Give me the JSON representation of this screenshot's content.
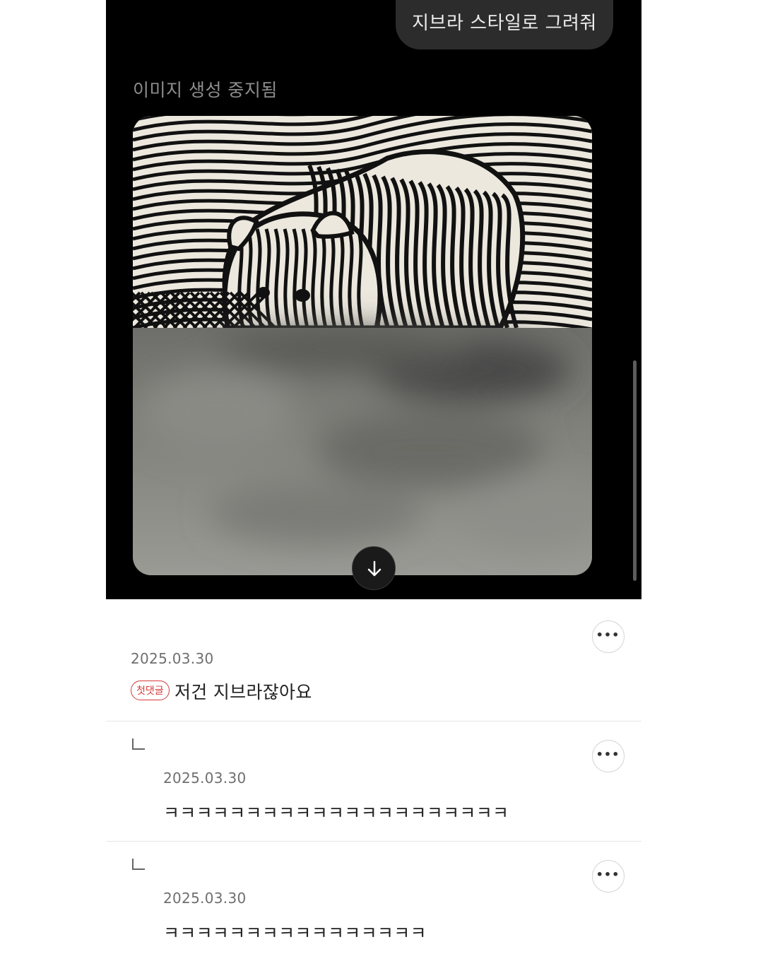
{
  "chat": {
    "user_prompt": "지브라 스타일로 그려줘",
    "status_text": "이미지 생성 중지됨",
    "image_label": "zebra-striped animal artwork, lower half blurred"
  },
  "icons": {
    "scroll_down": "arrow-down-icon",
    "more": "more-horizontal-icon",
    "reply": "reply-corner-icon"
  },
  "comments": [
    {
      "date": "2025.03.30",
      "badge": "첫댓글",
      "text": "저건 지브라잖아요",
      "is_reply": false
    },
    {
      "date": "2025.03.30",
      "text": "ㅋㅋㅋㅋㅋㅋㅋㅋㅋㅋㅋㅋㅋㅋㅋㅋㅋㅋㅋㅋㅋ",
      "is_reply": true
    },
    {
      "date": "2025.03.30",
      "text": "ㅋㅋㅋㅋㅋㅋㅋㅋㅋㅋㅋㅋㅋㅋㅋㅋ",
      "is_reply": true
    }
  ],
  "more_label": "•••",
  "colors": {
    "chat_bg": "#000000",
    "bubble_bg": "#2c2c2c",
    "badge_red": "#d43a3a",
    "image_paper": "#ece8de",
    "blur_gray": "#7a7a76"
  }
}
